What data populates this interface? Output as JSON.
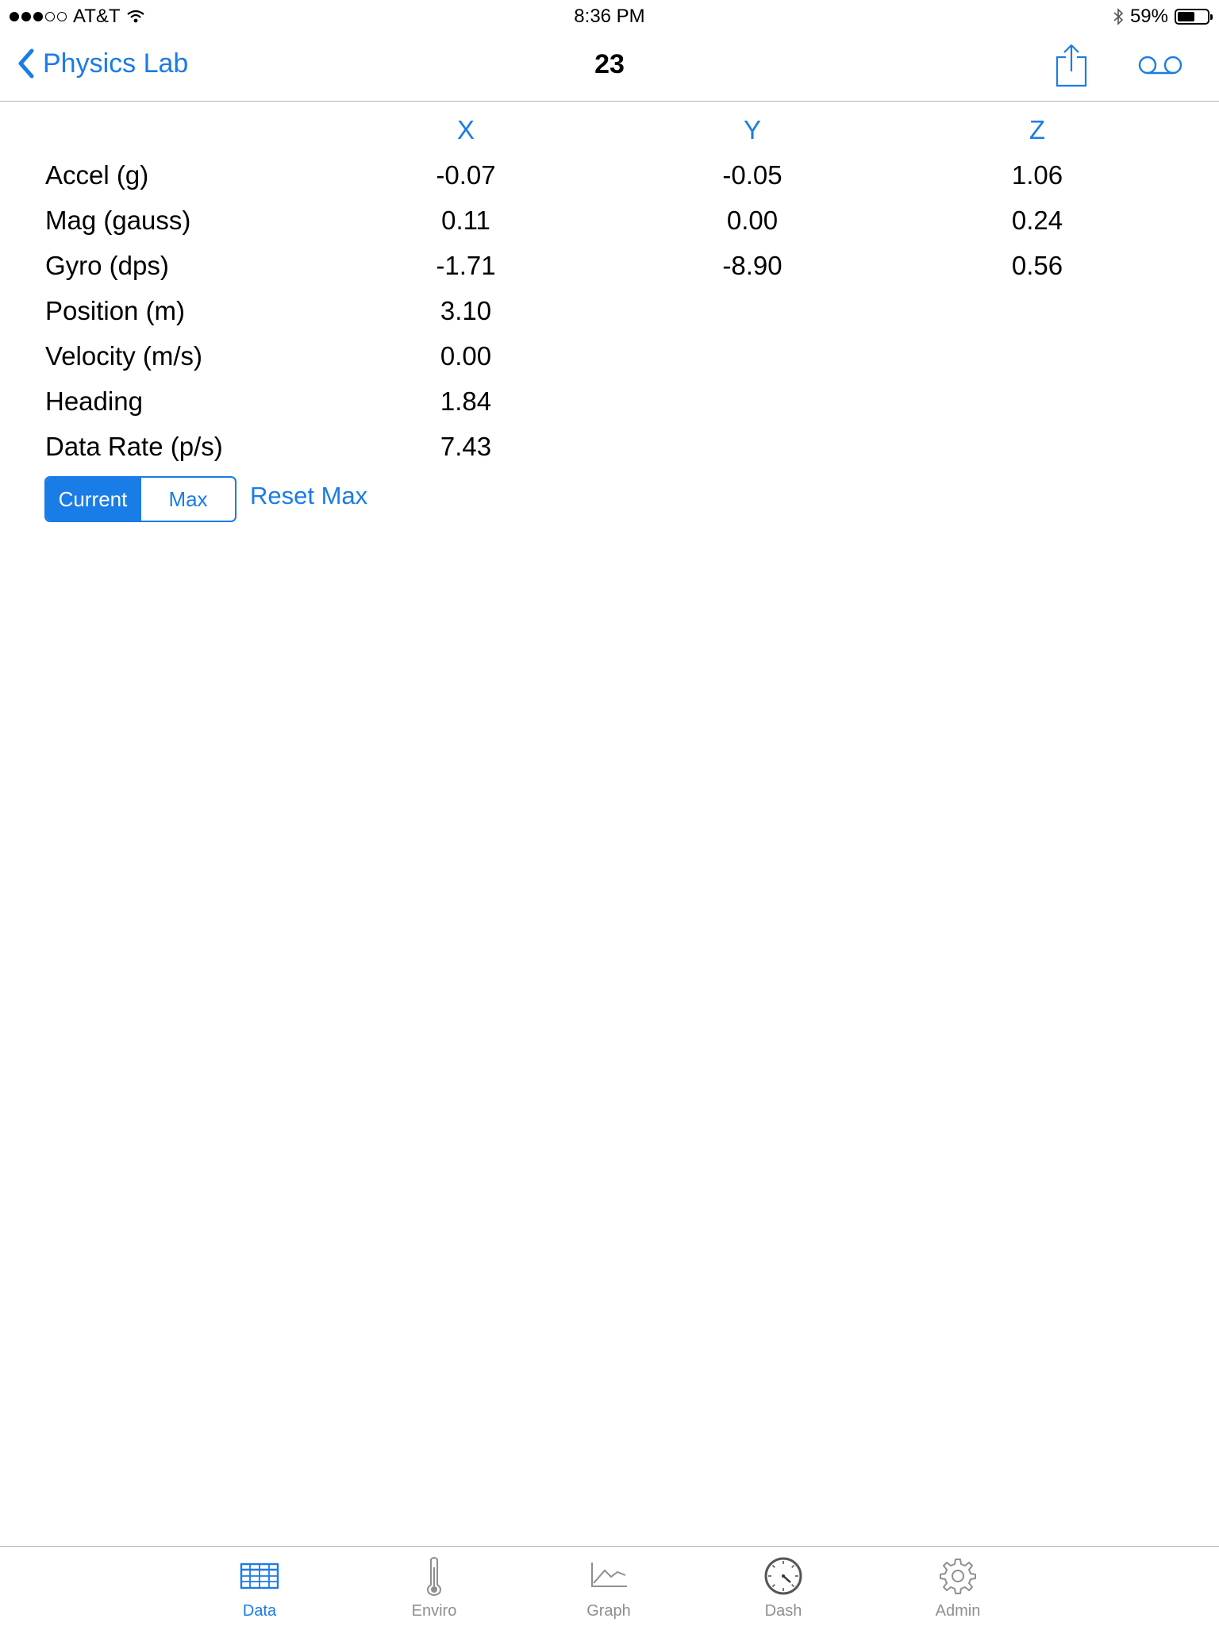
{
  "status_bar": {
    "carrier": "AT&T",
    "time": "8:36 PM",
    "battery_percent": "59%",
    "battery_level": 0.59,
    "signal_bars": 3,
    "signal_total": 5
  },
  "nav": {
    "back_label": "Physics Lab",
    "title": "23"
  },
  "table": {
    "columns": [
      "X",
      "Y",
      "Z"
    ],
    "rows": [
      {
        "label": "Accel (g)",
        "x": "-0.07",
        "y": "-0.05",
        "z": "1.06"
      },
      {
        "label": "Mag (gauss)",
        "x": "0.11",
        "y": "0.00",
        "z": "0.24"
      },
      {
        "label": "Gyro (dps)",
        "x": "-1.71",
        "y": "-8.90",
        "z": "0.56"
      },
      {
        "label": "Position (m)",
        "x": "3.10",
        "y": "",
        "z": ""
      },
      {
        "label": "Velocity (m/s)",
        "x": "0.00",
        "y": "",
        "z": ""
      },
      {
        "label": "Heading",
        "x": "1.84",
        "y": "",
        "z": ""
      },
      {
        "label": "Data Rate (p/s)",
        "x": "7.43",
        "y": "",
        "z": ""
      }
    ]
  },
  "controls": {
    "segment_current": "Current",
    "segment_max": "Max",
    "selected_segment": "Current",
    "reset_max": "Reset Max"
  },
  "tabs": [
    {
      "label": "Data",
      "icon": "table-icon",
      "active": true
    },
    {
      "label": "Enviro",
      "icon": "thermometer-icon",
      "active": false
    },
    {
      "label": "Graph",
      "icon": "graph-icon",
      "active": false
    },
    {
      "label": "Dash",
      "icon": "gauge-icon",
      "active": false
    },
    {
      "label": "Admin",
      "icon": "gear-icon",
      "active": false
    }
  ],
  "colors": {
    "accent": "#1a7ce6",
    "inactive": "#8e8e93",
    "separator": "#b2b2b2"
  }
}
